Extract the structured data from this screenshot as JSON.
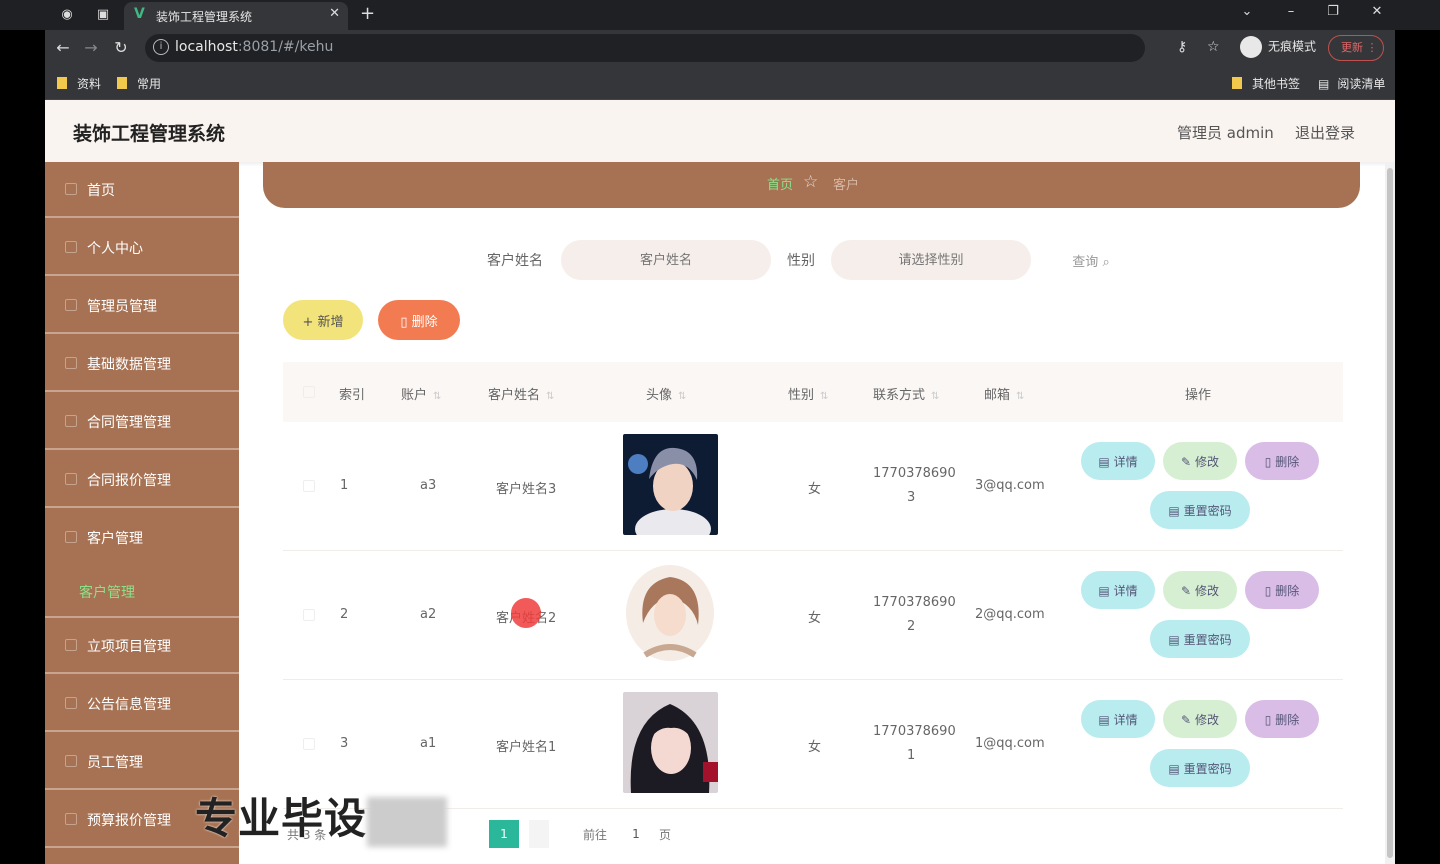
{
  "browser": {
    "tab_title": "装饰工程管理系统",
    "url_host": "localhost",
    "url_rest": ":8081/#/kehu",
    "incognito_label": "无痕模式",
    "update_label": "更新",
    "bookmarks": [
      "资料",
      "常用"
    ],
    "bookmarks_right": [
      "其他书签",
      "阅读清单"
    ]
  },
  "header": {
    "title": "装饰工程管理系统",
    "user_role": "管理员 admin",
    "logout": "退出登录"
  },
  "sidebar": {
    "items": [
      "首页",
      "个人中心",
      "管理员管理",
      "基础数据管理",
      "合同管理管理",
      "合同报价管理",
      "客户管理",
      "立项项目管理",
      "公告信息管理",
      "员工管理",
      "预算报价管理"
    ],
    "active_sub": "客户管理"
  },
  "breadcrumb": {
    "home": "首页",
    "current": "客户"
  },
  "search": {
    "name_label": "客户姓名",
    "name_placeholder": "客户姓名",
    "gender_label": "性别",
    "gender_placeholder": "请选择性别",
    "query_button": "查询"
  },
  "toolbar": {
    "add": "新增",
    "delete": "删除"
  },
  "table": {
    "headers": [
      "索引",
      "账户",
      "客户姓名",
      "头像",
      "性别",
      "联系方式",
      "邮箱",
      "操作"
    ],
    "rows": [
      {
        "index": "1",
        "account": "a3",
        "name": "客户姓名3",
        "gender": "女",
        "phone1": "1770378690",
        "phone2": "3",
        "email": "3@qq.com"
      },
      {
        "index": "2",
        "account": "a2",
        "name": "客户姓名2",
        "gender": "女",
        "phone1": "1770378690",
        "phone2": "2",
        "email": "2@qq.com"
      },
      {
        "index": "3",
        "account": "a1",
        "name": "客户姓名1",
        "gender": "女",
        "phone1": "1770378690",
        "phone2": "1",
        "email": "1@qq.com"
      }
    ],
    "ops": {
      "detail": "详情",
      "edit": "修改",
      "delete": "删除",
      "reset": "重置密码"
    }
  },
  "pagination": {
    "total": "共 3 条",
    "current": "1",
    "goto": "前往",
    "page_input": "1",
    "unit": "页"
  },
  "watermark": "专业毕设",
  "colors": {
    "sidebar": "#a77253",
    "active": "#8de08a",
    "add_btn": "#f2e37a",
    "del_btn": "#f27b52"
  }
}
